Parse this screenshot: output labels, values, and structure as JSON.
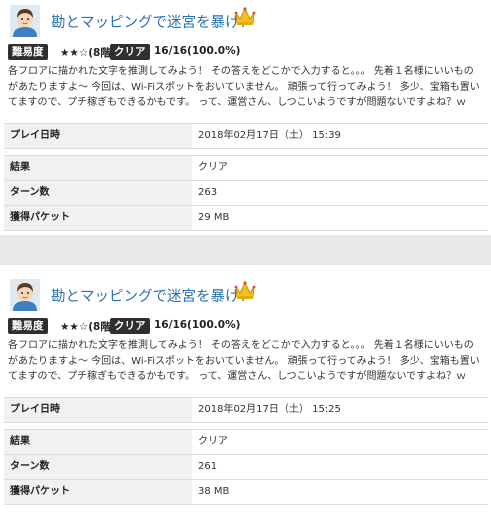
{
  "colors": {
    "title": "#2a6fb0",
    "badge_bg": "#2f2f2f",
    "key_bg": "#f1f1f1",
    "separator": "#e9e9e9"
  },
  "icons": {
    "avatar": "male-avatar-icon",
    "crown": "crown-icon"
  },
  "entries": [
    {
      "title": "勘とマッピングで迷宮を暴け！",
      "difficulty_label": "難易度",
      "difficulty_stars": "★★☆(8階)",
      "clear_label": "クリア",
      "clear_stats": "16/16(100.0%)",
      "description": "各フロアに描かれた文字を推測してみよう！ その答えをどこかで入力すると。。。 先着１名様にいいものがあたりますよ～ 今回は、Wi-Fiスポットをおいていません。 頑張って行ってみよう！ 多少、宝箱も置いてますので、プチ稼ぎもできるかもです。 って、運営さん、しつこいようですが問題ないですよね？ｗ",
      "play_date_label": "プレイ日時",
      "play_date": "2018年02月17日（土） 15:39",
      "rows": [
        {
          "label": "結果",
          "value": "クリア"
        },
        {
          "label": "ターン数",
          "value": "263"
        },
        {
          "label": "獲得パケット",
          "value": "29 MB"
        }
      ]
    },
    {
      "title": "勘とマッピングで迷宮を暴け！",
      "difficulty_label": "難易度",
      "difficulty_stars": "★★☆(8階)",
      "clear_label": "クリア",
      "clear_stats": "16/16(100.0%)",
      "description": "各フロアに描かれた文字を推測してみよう！ その答えをどこかで入力すると。。。 先着１名様にいいものがあたりますよ～ 今回は、Wi-Fiスポットをおいていません。 頑張って行ってみよう！ 多少、宝箱も置いてますので、プチ稼ぎもできるかもです。 って、運営さん、しつこいようですが問題ないですよね？ｗ",
      "play_date_label": "プレイ日時",
      "play_date": "2018年02月17日（土） 15:25",
      "rows": [
        {
          "label": "結果",
          "value": "クリア"
        },
        {
          "label": "ターン数",
          "value": "261"
        },
        {
          "label": "獲得パケット",
          "value": "38 MB"
        }
      ]
    }
  ]
}
